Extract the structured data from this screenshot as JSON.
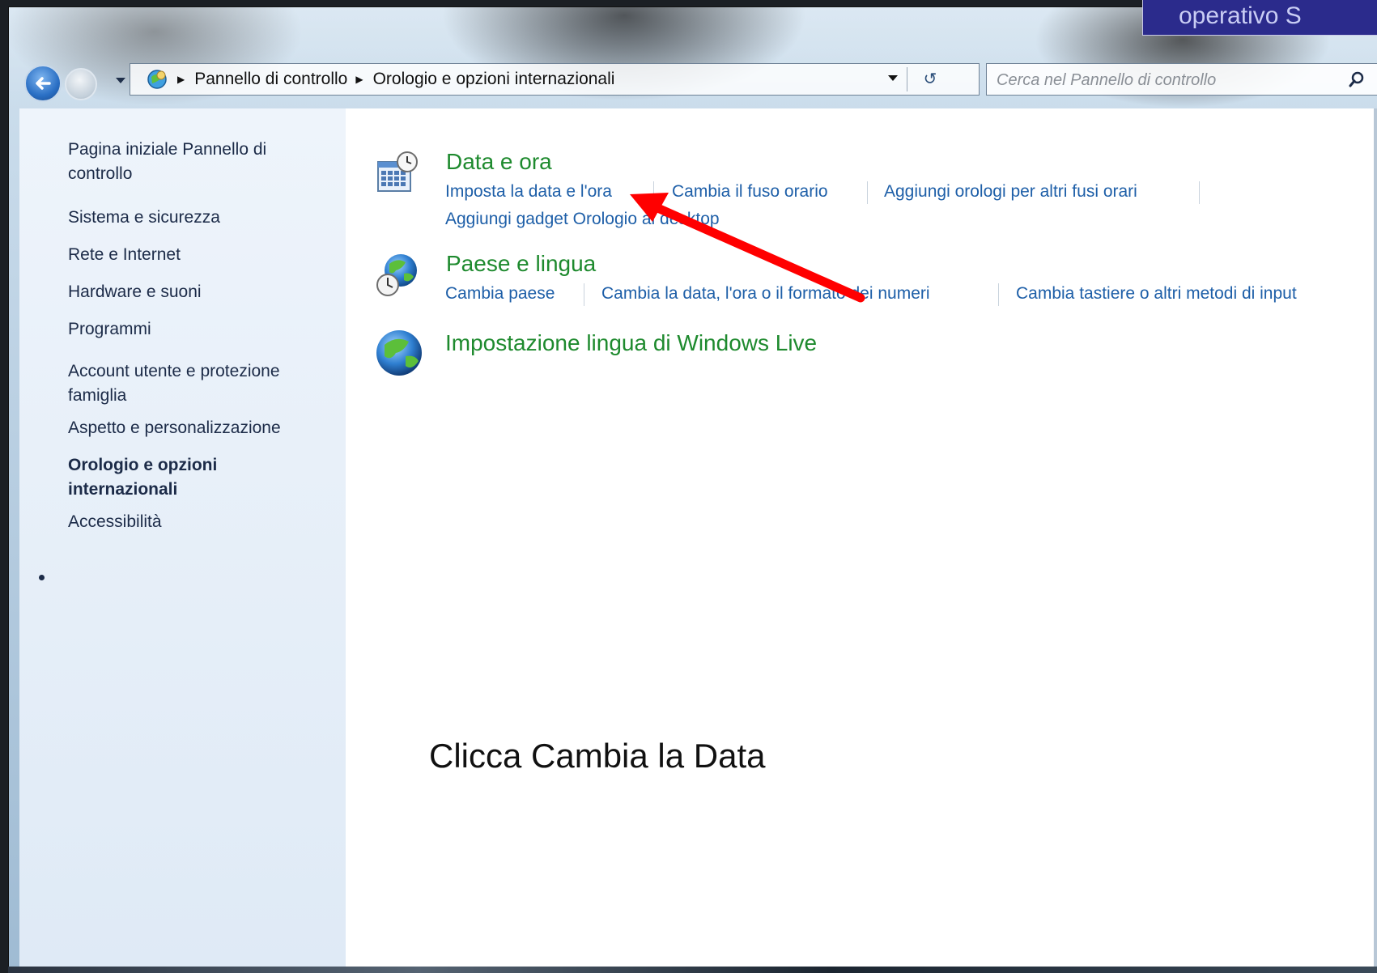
{
  "overlay": {
    "title": "operativo S"
  },
  "addressbar": {
    "crumbs": [
      "Pannello di controllo",
      "Orologio e opzioni internazionali"
    ]
  },
  "search": {
    "placeholder": "Cerca nel Pannello di controllo"
  },
  "sidebar": {
    "items": [
      {
        "label": "Pagina iniziale Pannello di controllo"
      },
      {
        "label": "Sistema e sicurezza"
      },
      {
        "label": "Rete e Internet"
      },
      {
        "label": "Hardware e suoni"
      },
      {
        "label": "Programmi"
      },
      {
        "label": "Account utente e protezione famiglia"
      },
      {
        "label": "Aspetto e personalizzazione"
      },
      {
        "label": "Orologio e opzioni internazionali",
        "current": true
      },
      {
        "label": "Accessibilità"
      }
    ]
  },
  "main": {
    "categories": [
      {
        "title": "Data e ora",
        "icon": "calendar-clock-icon",
        "tasks": [
          "Imposta la data e l'ora",
          "Cambia il fuso orario",
          "Aggiungi orologi per altri fusi orari",
          "Aggiungi gadget Orologio al desktop"
        ]
      },
      {
        "title": "Paese e lingua",
        "icon": "globe-clock-icon",
        "tasks": [
          "Cambia paese",
          "Cambia la data, l'ora o il formato dei numeri",
          "Cambia tastiere o altri metodi di input"
        ]
      },
      {
        "title": "Impostazione lingua di Windows Live",
        "icon": "globe-icon",
        "tasks": []
      }
    ]
  },
  "annotation": {
    "text": "Clicca  Cambia la Data",
    "arrow_color": "#ff0000"
  },
  "colors": {
    "category_green": "#1e8a2e",
    "link_blue": "#1e5fa8",
    "overlay_bg": "#2b2b8c"
  }
}
